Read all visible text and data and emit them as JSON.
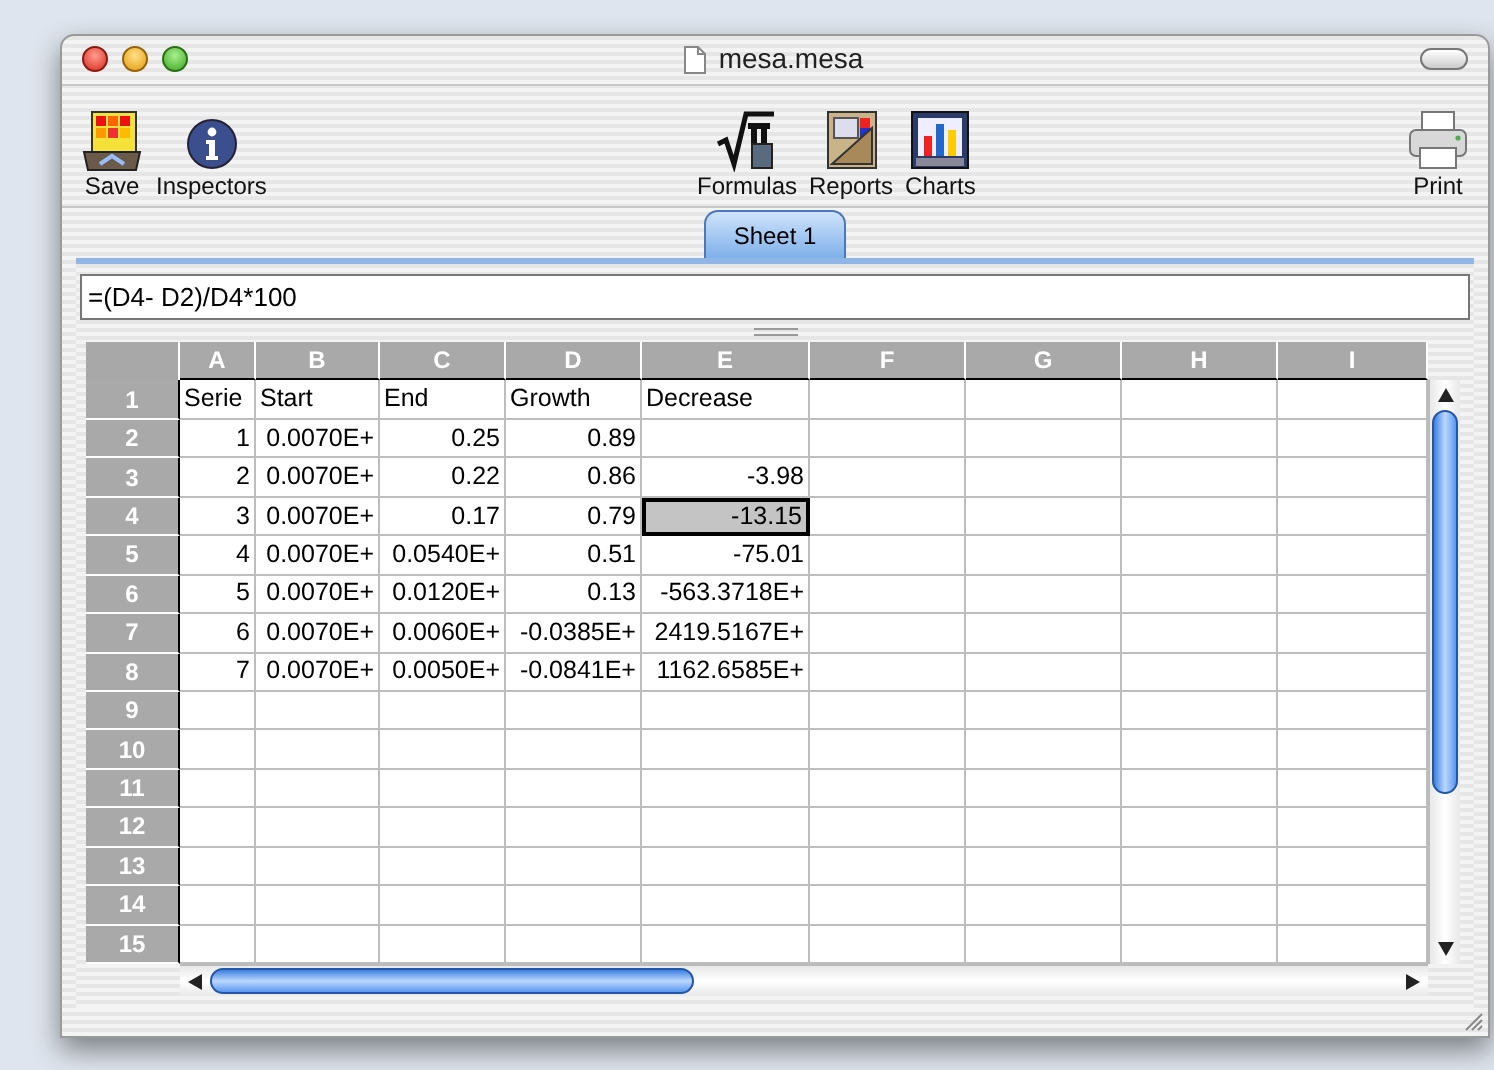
{
  "window": {
    "title": "mesa.mesa"
  },
  "toolbar": [
    {
      "kind": "save",
      "label": "Save"
    },
    {
      "kind": "inspectors",
      "label": "Inspectors"
    },
    {
      "kind": "formulas",
      "label": "Formulas"
    },
    {
      "kind": "reports",
      "label": "Reports"
    },
    {
      "kind": "charts",
      "label": "Charts"
    },
    {
      "kind": "print",
      "label": "Print"
    }
  ],
  "tabs": [
    {
      "label": "Sheet 1",
      "selected": true
    }
  ],
  "formula_bar": {
    "value": "=(D4- D2)/D4*100"
  },
  "table": {
    "columns": [
      "A",
      "B",
      "C",
      "D",
      "E",
      "F",
      "G",
      "H",
      "I"
    ],
    "rows": [
      {
        "label": "1",
        "kind": "labels",
        "cells": [
          {
            "text": "Serie",
            "selected": false
          },
          {
            "text": "Start",
            "selected": false
          },
          {
            "text": "End",
            "selected": false
          },
          {
            "text": "Growth",
            "selected": false
          },
          {
            "text": "Decrease",
            "selected": false
          }
        ]
      },
      {
        "label": "2",
        "kind": "data",
        "cells": [
          {
            "text": "1",
            "selected": false
          },
          {
            "text": "0.0070E+",
            "selected": false
          },
          {
            "text": "0.25",
            "selected": false
          },
          {
            "text": "0.89",
            "selected": false
          }
        ]
      },
      {
        "label": "3",
        "kind": "data",
        "cells": [
          {
            "text": "2",
            "selected": false
          },
          {
            "text": "0.0070E+",
            "selected": false
          },
          {
            "text": "0.22",
            "selected": false
          },
          {
            "text": "0.86",
            "selected": false
          },
          {
            "text": "-3.98",
            "selected": false
          }
        ]
      },
      {
        "label": "4",
        "kind": "data",
        "cells": [
          {
            "text": "3",
            "selected": false
          },
          {
            "text": "0.0070E+",
            "selected": false
          },
          {
            "text": "0.17",
            "selected": false
          },
          {
            "text": "0.79",
            "selected": false
          },
          {
            "text": "-13.15",
            "selected": true
          }
        ]
      },
      {
        "label": "5",
        "kind": "data",
        "cells": [
          {
            "text": "4",
            "selected": false
          },
          {
            "text": "0.0070E+",
            "selected": false
          },
          {
            "text": "0.0540E+",
            "selected": false
          },
          {
            "text": "0.51",
            "selected": false
          },
          {
            "text": "-75.01",
            "selected": false
          }
        ]
      },
      {
        "label": "6",
        "kind": "data",
        "cells": [
          {
            "text": "5",
            "selected": false
          },
          {
            "text": "0.0070E+",
            "selected": false
          },
          {
            "text": "0.0120E+",
            "selected": false
          },
          {
            "text": "0.13",
            "selected": false
          },
          {
            "text": "-563.3718E+",
            "selected": false
          }
        ]
      },
      {
        "label": "7",
        "kind": "data",
        "cells": [
          {
            "text": "6",
            "selected": false
          },
          {
            "text": "0.0070E+",
            "selected": false
          },
          {
            "text": "0.0060E+",
            "selected": false
          },
          {
            "text": "-0.0385E+",
            "selected": false
          },
          {
            "text": "2419.5167E+",
            "selected": false
          }
        ]
      },
      {
        "label": "8",
        "kind": "data",
        "cells": [
          {
            "text": "7",
            "selected": false
          },
          {
            "text": "0.0070E+",
            "selected": false
          },
          {
            "text": "0.0050E+",
            "selected": false
          },
          {
            "text": "-0.0841E+",
            "selected": false
          },
          {
            "text": "1162.6585E+",
            "selected": false
          }
        ]
      },
      {
        "label": "9"
      },
      {
        "label": "10"
      },
      {
        "label": "11"
      },
      {
        "label": "12"
      },
      {
        "label": "13"
      },
      {
        "label": "14"
      },
      {
        "label": "15"
      }
    ]
  }
}
